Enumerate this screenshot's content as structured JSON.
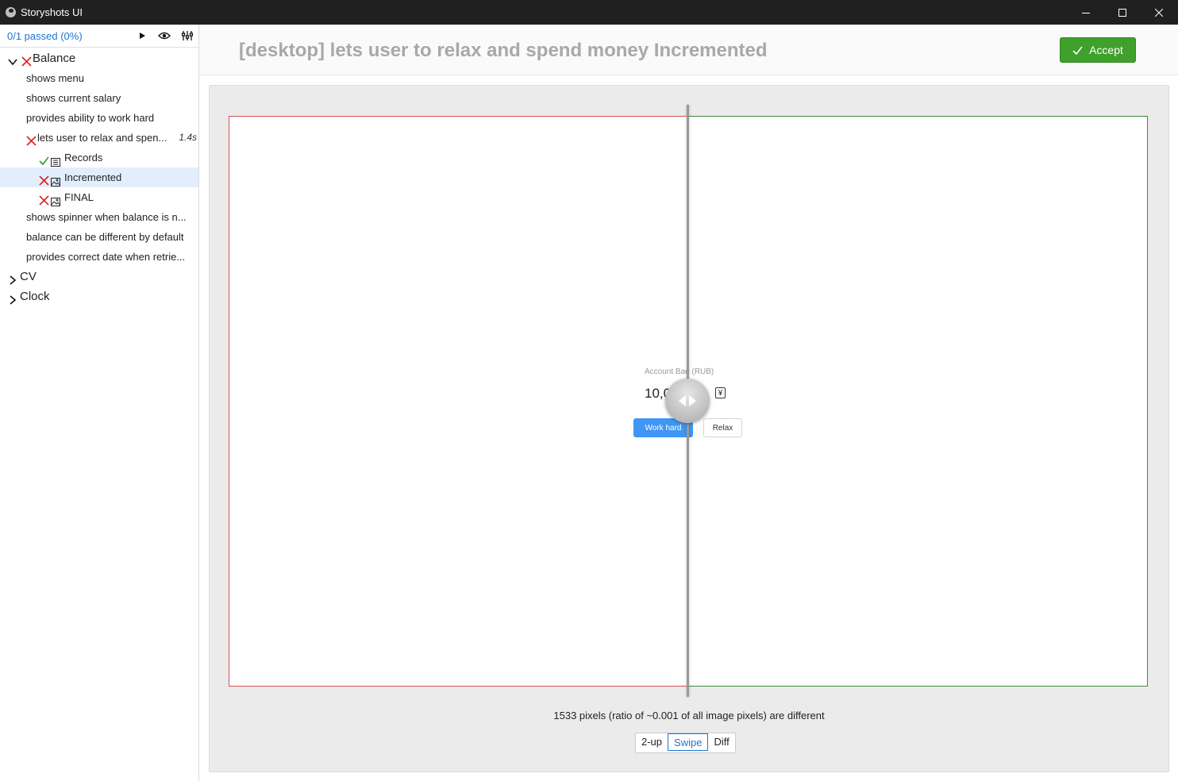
{
  "window": {
    "title": "Storyshots UI"
  },
  "sidebar": {
    "status": "0/1 passed (0%)",
    "tree": [
      {
        "label": "Balance"
      },
      {
        "label": "shows menu"
      },
      {
        "label": "shows current salary"
      },
      {
        "label": "provides ability to work hard"
      },
      {
        "label": "lets user to relax and spen...",
        "duration": "1.4s"
      },
      {
        "label": "Records"
      },
      {
        "label": "Incremented"
      },
      {
        "label": "FINAL"
      },
      {
        "label": "shows spinner when balance is n..."
      },
      {
        "label": "balance can be different by default"
      },
      {
        "label": "provides correct date when retrie..."
      },
      {
        "label": "CV"
      },
      {
        "label": "Clock"
      }
    ]
  },
  "header": {
    "title": "[desktop] lets user to relax and spend money Incremented",
    "accept_label": "Accept"
  },
  "preview": {
    "label": "Account Bae (RUB)",
    "value": "10,0",
    "currency_icon": "¥",
    "work_button": "Work hard",
    "relax_button": "Relax"
  },
  "diff": {
    "summary": "1533 pixels (ratio of ~0.001 of all image pixels) are different",
    "modes": [
      "2-up",
      "Swipe",
      "Diff"
    ],
    "active_mode": "Swipe"
  },
  "colors": {
    "accent": "#1e76d3",
    "accept": "#3fa02c",
    "fail": "#e02020",
    "pass": "#2a9d2a",
    "old_border": "#d9534f",
    "new_border": "#3d8b3d"
  }
}
